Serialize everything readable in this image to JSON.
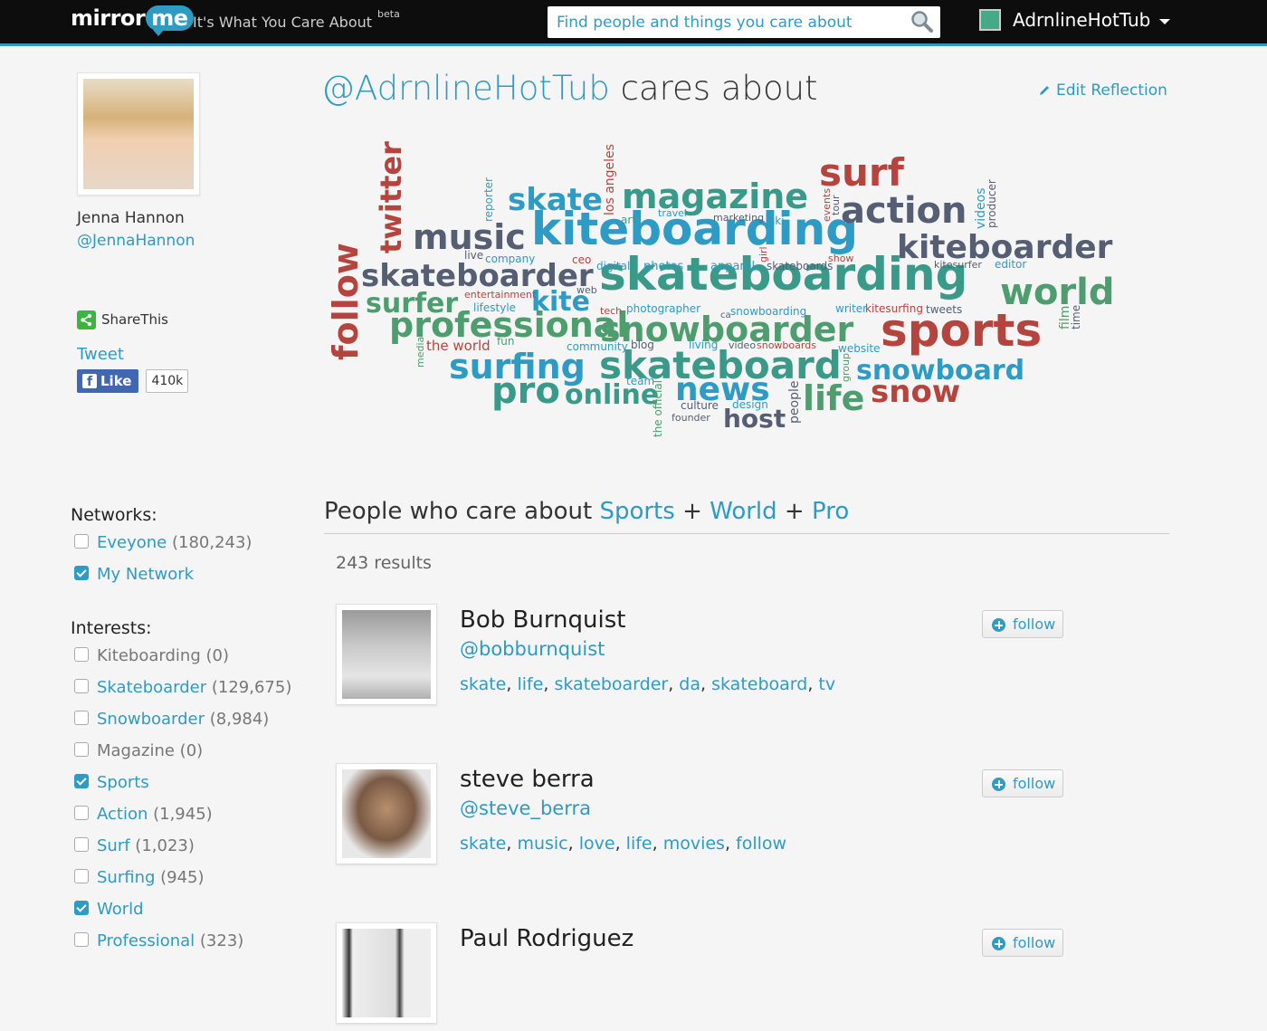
{
  "header": {
    "logo_text": "mirror",
    "logo_bubble": "me",
    "tagline": "It's What You Care About",
    "beta": "beta",
    "search_placeholder": "Find people and things you care about",
    "username": "AdrnlineHotTub"
  },
  "profile": {
    "name": "Jenna Hannon",
    "handle": "@JennaHannon",
    "sharethis": "ShareThis",
    "tweet": "Tweet",
    "fb_like": "Like",
    "fb_count": "410k"
  },
  "reflection": {
    "user": "@AdrnlineHotTub",
    "suffix": " cares about",
    "edit_label": "Edit Reflection"
  },
  "colors": {
    "blue": "#2e9bc4",
    "teal": "#3a9a8a",
    "red": "#b5443f",
    "slate": "#555e73",
    "green": "#4e9d6e",
    "brown": "#a55a4a"
  },
  "wordcloud": [
    {
      "w": "kiteboarding",
      "c": "blue"
    },
    {
      "w": "skateboarding",
      "c": "teal"
    },
    {
      "w": "sports",
      "c": "red"
    },
    {
      "w": "skateboard",
      "c": "teal"
    },
    {
      "w": "professional",
      "c": "green"
    },
    {
      "w": "snowboarder",
      "c": "green"
    },
    {
      "w": "magazine",
      "c": "teal"
    },
    {
      "w": "kiteboarder",
      "c": "slate"
    },
    {
      "w": "skateboarder",
      "c": "slate"
    },
    {
      "w": "surfing",
      "c": "blue"
    },
    {
      "w": "world",
      "c": "green"
    },
    {
      "w": "action",
      "c": "slate"
    },
    {
      "w": "music",
      "c": "slate"
    },
    {
      "w": "snowboard",
      "c": "blue"
    },
    {
      "w": "news",
      "c": "blue"
    },
    {
      "w": "surf",
      "c": "red"
    },
    {
      "w": "life",
      "c": "green"
    },
    {
      "w": "skate",
      "c": "blue"
    },
    {
      "w": "pro",
      "c": "teal"
    },
    {
      "w": "snow",
      "c": "red"
    },
    {
      "w": "online",
      "c": "teal"
    },
    {
      "w": "host",
      "c": "slate"
    },
    {
      "w": "surfer",
      "c": "green"
    },
    {
      "w": "kite",
      "c": "blue"
    },
    {
      "w": "twitter",
      "c": "red"
    },
    {
      "w": "follow",
      "c": "red"
    },
    {
      "w": "the world",
      "c": "red"
    },
    {
      "w": "los angeles",
      "c": "red"
    },
    {
      "w": "people",
      "c": "slate"
    },
    {
      "w": "videos",
      "c": "blue"
    },
    {
      "w": "producer",
      "c": "slate"
    },
    {
      "w": "film",
      "c": "green"
    },
    {
      "w": "time",
      "c": "slate"
    },
    {
      "w": "events",
      "c": "red"
    },
    {
      "w": "tour",
      "c": "slate"
    },
    {
      "w": "reporter",
      "c": "blue"
    },
    {
      "w": "art",
      "c": "teal"
    },
    {
      "w": "travel",
      "c": "blue"
    },
    {
      "w": "marketing",
      "c": "slate"
    },
    {
      "w": "ski",
      "c": "blue"
    },
    {
      "w": "girl",
      "c": "red"
    },
    {
      "w": "live",
      "c": "slate"
    },
    {
      "w": "company",
      "c": "blue"
    },
    {
      "w": "ceo",
      "c": "red"
    },
    {
      "w": "digital",
      "c": "blue"
    },
    {
      "w": "photos",
      "c": "blue"
    },
    {
      "w": "apparel",
      "c": "blue"
    },
    {
      "w": "skateboards",
      "c": "slate"
    },
    {
      "w": "show",
      "c": "red"
    },
    {
      "w": "kitesurfer",
      "c": "slate"
    },
    {
      "w": "editor",
      "c": "blue"
    },
    {
      "w": "entertainment",
      "c": "red"
    },
    {
      "w": "web",
      "c": "slate"
    },
    {
      "w": "lifestyle",
      "c": "blue"
    },
    {
      "w": "tech",
      "c": "red"
    },
    {
      "w": "photographer",
      "c": "blue"
    },
    {
      "w": "ca",
      "c": "slate"
    },
    {
      "w": "snowboarding",
      "c": "blue"
    },
    {
      "w": "writer",
      "c": "blue"
    },
    {
      "w": "kitesurfing",
      "c": "red"
    },
    {
      "w": "tweets",
      "c": "slate"
    },
    {
      "w": "media",
      "c": "green"
    },
    {
      "w": "fun",
      "c": "green"
    },
    {
      "w": "community",
      "c": "blue"
    },
    {
      "w": "blog",
      "c": "slate"
    },
    {
      "w": "living",
      "c": "blue"
    },
    {
      "w": "video",
      "c": "slate"
    },
    {
      "w": "snowboards",
      "c": "red"
    },
    {
      "w": "website",
      "c": "blue"
    },
    {
      "w": "group",
      "c": "green"
    },
    {
      "w": "team",
      "c": "blue"
    },
    {
      "w": "the official",
      "c": "green"
    },
    {
      "w": "culture",
      "c": "slate"
    },
    {
      "w": "design",
      "c": "blue"
    },
    {
      "w": "founder",
      "c": "slate"
    }
  ],
  "filters": {
    "networks_heading": "Networks:",
    "networks": [
      {
        "label": "Eveyone",
        "count": "(180,243)",
        "checked": false,
        "muted": false
      },
      {
        "label": "My Network",
        "count": "",
        "checked": true,
        "muted": false
      }
    ],
    "interests_heading": "Interests:",
    "interests": [
      {
        "label": "Kiteboarding",
        "count": "(0)",
        "checked": false,
        "muted": true
      },
      {
        "label": "Skateboarder",
        "count": "(129,675)",
        "checked": false,
        "muted": false
      },
      {
        "label": "Snowboarder",
        "count": "(8,984)",
        "checked": false,
        "muted": false
      },
      {
        "label": "Magazine",
        "count": "(0)",
        "checked": false,
        "muted": true
      },
      {
        "label": "Sports",
        "count": "",
        "checked": true,
        "muted": false
      },
      {
        "label": "Action",
        "count": "(1,945)",
        "checked": false,
        "muted": false
      },
      {
        "label": "Surf",
        "count": "(1,023)",
        "checked": false,
        "muted": false
      },
      {
        "label": "Surfing",
        "count": "(945)",
        "checked": false,
        "muted": false
      },
      {
        "label": "World",
        "count": "",
        "checked": true,
        "muted": false
      },
      {
        "label": "Professional",
        "count": "(323)",
        "checked": false,
        "muted": false
      }
    ]
  },
  "results": {
    "heading_prefix": "People who care about ",
    "terms": [
      "Sports",
      "World",
      "Pro"
    ],
    "plus": " + ",
    "count_text": "243 results",
    "follow_label": "follow",
    "people": [
      {
        "name": "Bob Burnquist",
        "handle": "@bobburnquist",
        "tags": [
          "skate",
          "life",
          "skateboarder",
          "da",
          "skateboard",
          "tv"
        ]
      },
      {
        "name": "steve berra",
        "handle": "@steve_berra",
        "tags": [
          "skate",
          "music",
          "love",
          "life",
          "movies",
          "follow"
        ]
      },
      {
        "name": "Paul Rodriguez",
        "handle": "",
        "tags": []
      }
    ]
  }
}
